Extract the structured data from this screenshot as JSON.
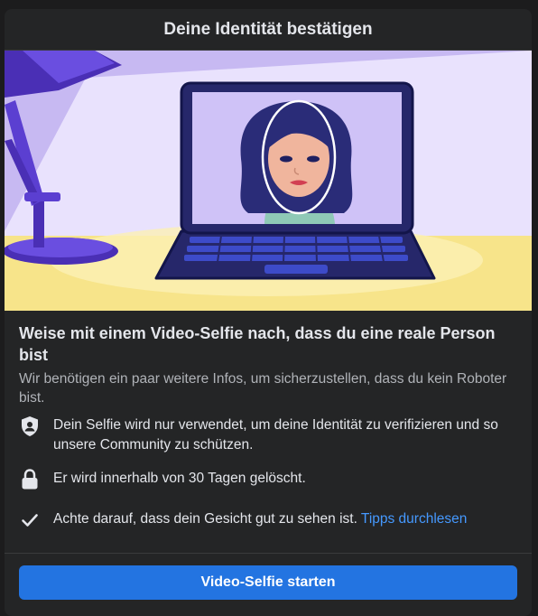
{
  "dialog": {
    "title": "Deine Identität bestätigen"
  },
  "main": {
    "heading": "Weise mit einem Video-Selfie nach, dass du eine reale Person bist",
    "subheading": "Wir benötigen ein paar weitere Infos, um sicherzustellen, dass du kein Roboter bist."
  },
  "items": [
    {
      "icon": "shield-person-icon",
      "text": "Dein Selfie wird nur verwendet, um deine Identität zu verifizieren und so unsere Community zu schützen."
    },
    {
      "icon": "lock-icon",
      "text": "Er wird innerhalb von 30 Tagen gelöscht."
    },
    {
      "icon": "check-icon",
      "text": "Achte darauf, dass dein Gesicht gut zu sehen ist.",
      "link": "Tipps durchlesen"
    }
  ],
  "footer": {
    "button_label": "Video-Selfie starten"
  },
  "colors": {
    "background": "#242526",
    "primary_button": "#2374e1",
    "link": "#4599ff",
    "text_primary": "#e4e6eb",
    "text_secondary": "#b0b3b8"
  }
}
